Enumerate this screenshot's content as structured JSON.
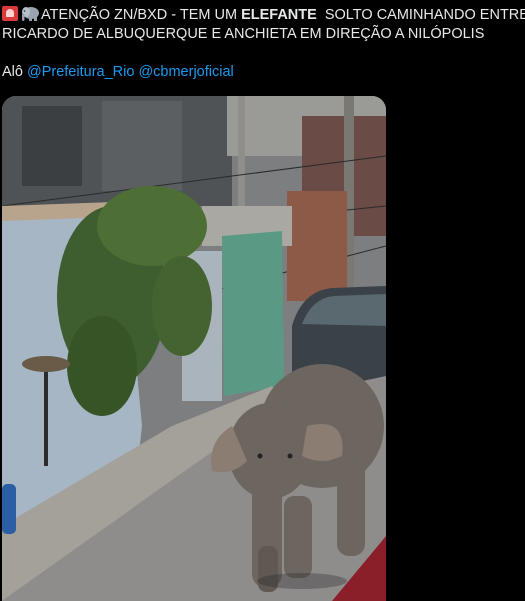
{
  "tweet": {
    "line1_prefix": "ATENÇÃO ZN/BXD - TEM UM ",
    "line1_bold": "ELEFANTE",
    "line1_suffix": "  SOLTO CAMINHANDO ENTRE",
    "line2": "RICARDO DE ALBUQUERQUE E ANCHIETA EM DIREÇÃO A NILÓPOLIS",
    "mention_prefix": "Alô ",
    "mention_1": "@Prefeitura_Rio",
    "mention_2": "@cbmerjoficial",
    "icons": [
      "siren-icon",
      "elephant-icon"
    ]
  },
  "colors": {
    "background": "#000000",
    "text": "#e7e9ea",
    "link": "#1d9bf0"
  }
}
